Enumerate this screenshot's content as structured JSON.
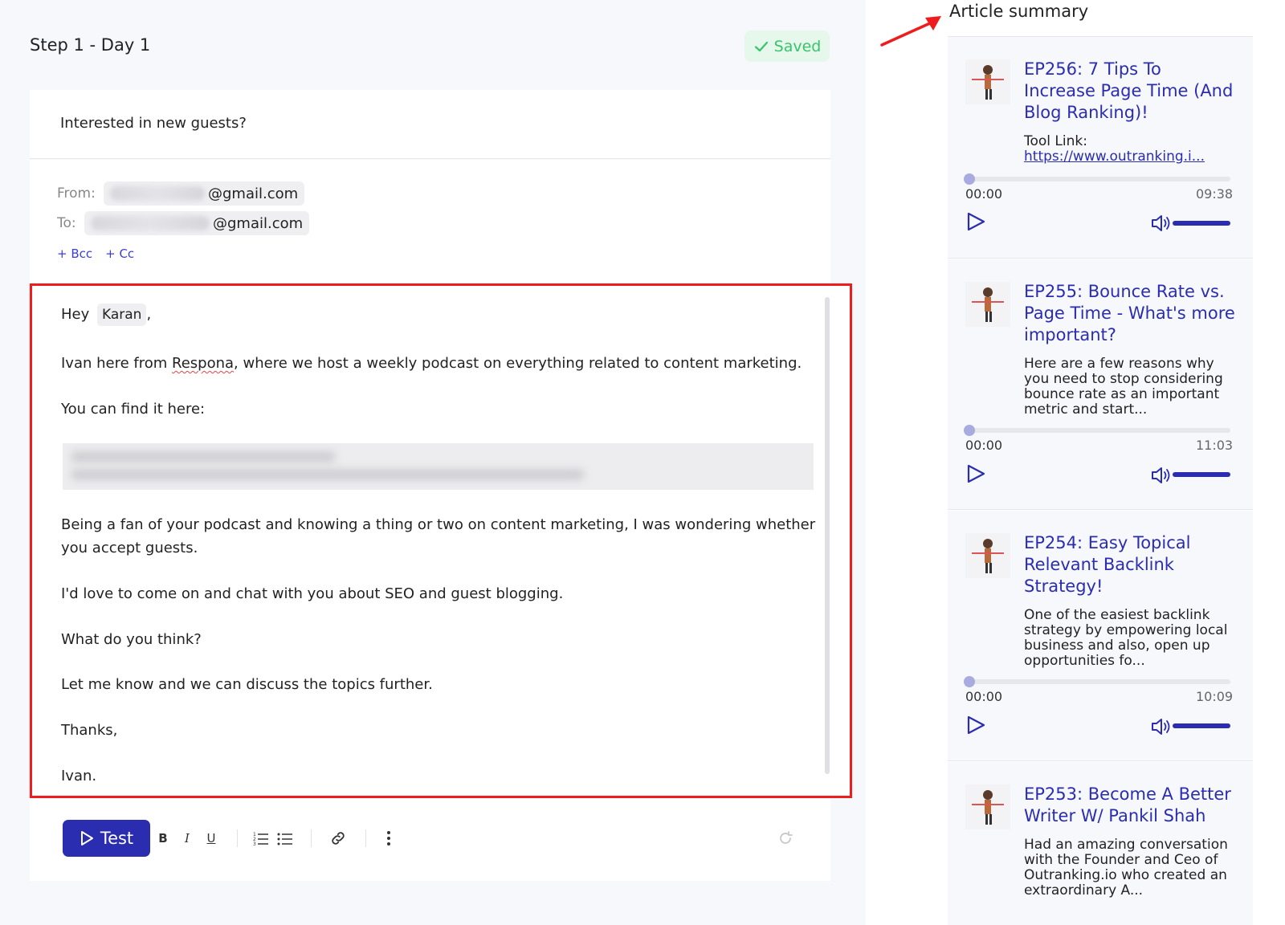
{
  "step": {
    "title": "Step 1 - Day 1",
    "saved_label": "Saved"
  },
  "email": {
    "subject": "Interested in new guests?",
    "from_label": "From:",
    "from_domain": "@gmail.com",
    "to_label": "To:",
    "to_domain": "@gmail.com",
    "bcc_label": "+ Bcc",
    "cc_label": "+ Cc"
  },
  "body": {
    "greeting": "Hey",
    "recipient_var": "Karan",
    "greeting_tail": ",",
    "intro_a": "Ivan here from ",
    "company": "Respona",
    "intro_b": ", where we host a weekly podcast on everything related to content marketing.",
    "find_here": "You can find it here:",
    "para1_line1": "Being a fan of your podcast and knowing a thing or two on content marketing, I was wondering whether",
    "para1_line2": "you accept guests.",
    "para2": "I'd love to come on and chat with you about SEO and guest blogging.",
    "para3": "What do you think?",
    "para4": "Let me know and we can discuss the topics further.",
    "thanks": "Thanks,",
    "signature": "Ivan."
  },
  "toolbar": {
    "test_label": "Test",
    "bold": "B",
    "italic": "I",
    "underline": "U"
  },
  "sidebar": {
    "title": "Article summary",
    "episodes": [
      {
        "title": "EP256: 7 Tips To Increase Page Time (And Blog Ranking)!",
        "desc_prefix": "Tool Link:",
        "desc_link": "https://www.outranking.i...",
        "start": "00:00",
        "end": "09:38",
        "progress": 0
      },
      {
        "title": "EP255: Bounce Rate vs. Page Time - What's more important?",
        "desc": "Here are a few reasons why you need to stop considering bounce rate as an important metric and start...",
        "start": "00:00",
        "end": "11:03",
        "progress": 0
      },
      {
        "title": "EP254: Easy Topical Relevant Backlink Strategy!",
        "desc": "One of the easiest backlink strategy by empowering local business and also, open up opportunities fo...",
        "start": "00:00",
        "end": "10:09",
        "progress": 0
      },
      {
        "title": "EP253: Become A Better Writer W/ Pankil Shah",
        "desc": "Had an amazing conversation with the Founder and Ceo of Outranking.io who created an extraordinary A..."
      }
    ]
  },
  "colors": {
    "accent": "#2b2db0",
    "highlight_border": "#ee1c1c",
    "saved_green": "#39c46b"
  },
  "icons": [
    "check-icon",
    "play-icon",
    "volume-icon",
    "link-icon",
    "ordered-list-icon",
    "bullet-list-icon",
    "more-icon",
    "refresh-icon",
    "arrow-icon"
  ]
}
